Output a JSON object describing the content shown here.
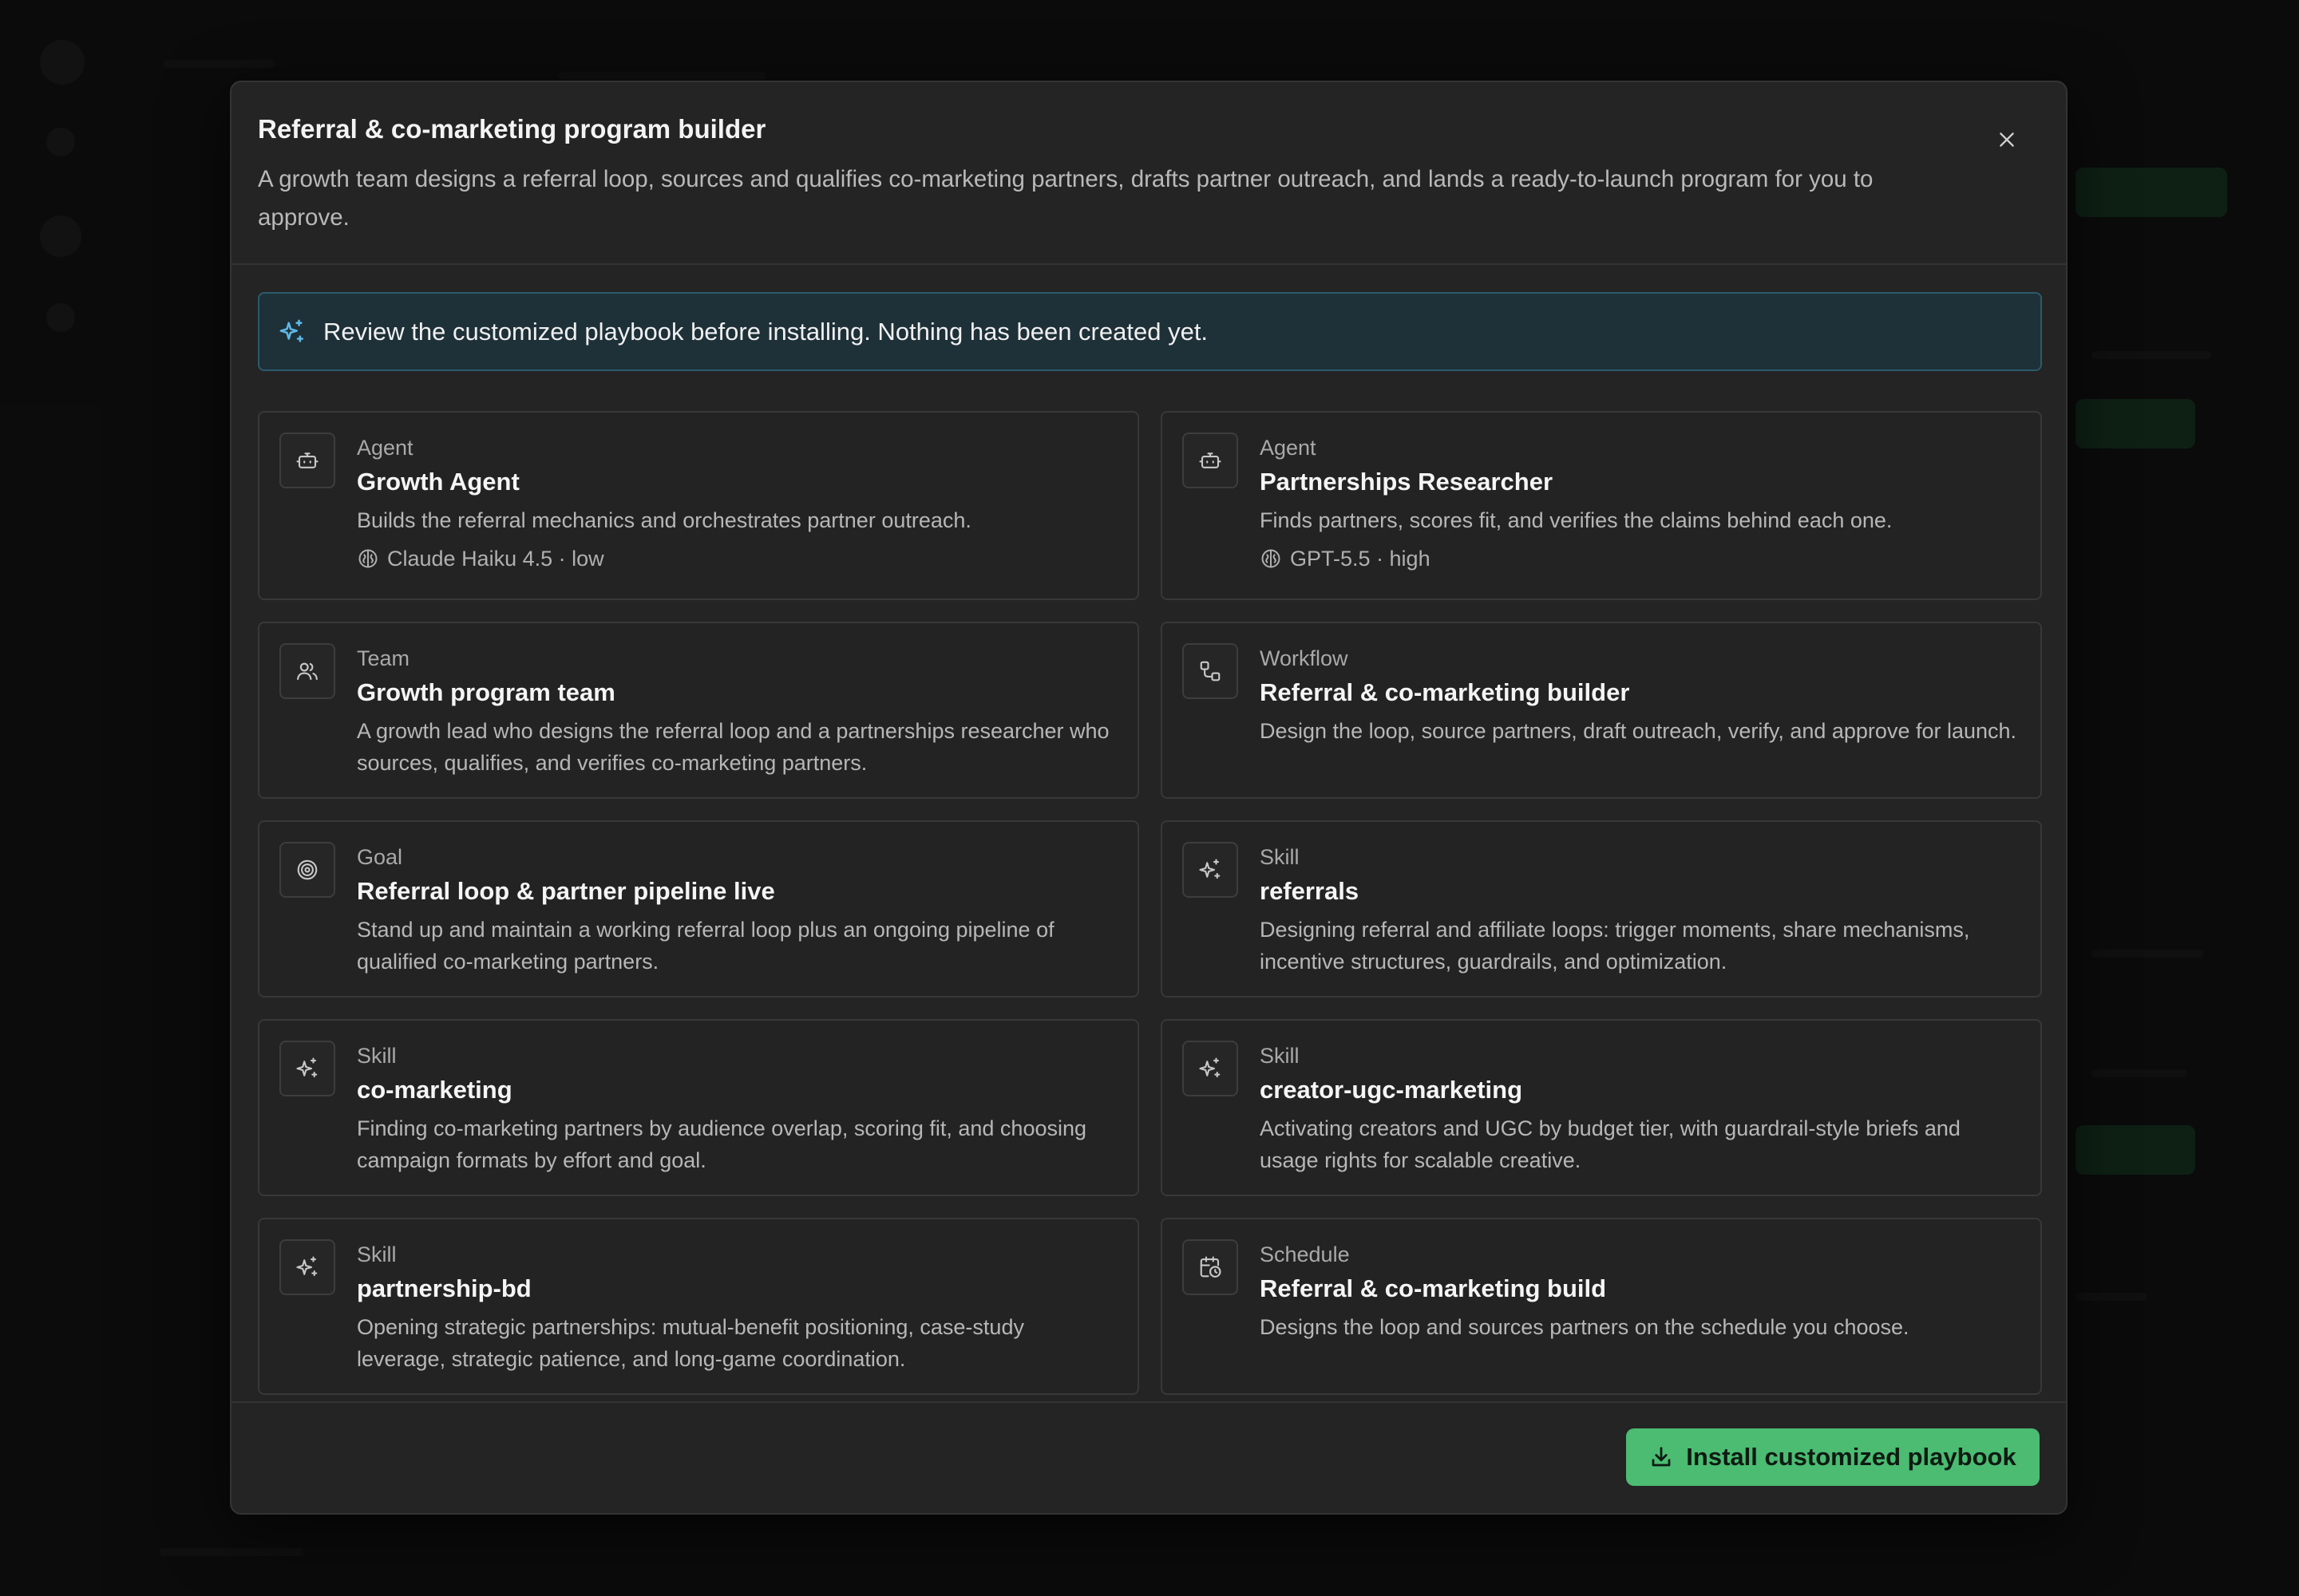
{
  "modal": {
    "title": "Referral & co-marketing program builder",
    "description": "A growth team designs a referral loop, sources and qualifies co-marketing partners, drafts partner outreach, and lands a ready-to-launch program for you to approve.",
    "close_icon": "close-icon"
  },
  "notice": {
    "icon": "sparkles-icon",
    "text": "Review the customized playbook before installing. Nothing has been created yet."
  },
  "cards": [
    {
      "kind": "Agent",
      "title": "Growth Agent",
      "description": "Builds the referral mechanics and orchestrates partner outreach.",
      "meta": "Claude Haiku 4.5 · low",
      "icon": "bot-icon"
    },
    {
      "kind": "Agent",
      "title": "Partnerships Researcher",
      "description": "Finds partners, scores fit, and verifies the claims behind each one.",
      "meta": "GPT-5.5 · high",
      "icon": "bot-icon"
    },
    {
      "kind": "Team",
      "title": "Growth program team",
      "description": "A growth lead who designs the referral loop and a partnerships researcher who sources, qualifies, and verifies co-marketing partners.",
      "icon": "users-icon"
    },
    {
      "kind": "Workflow",
      "title": "Referral & co-marketing builder",
      "description": "Design the loop, source partners, draft outreach, verify, and approve for launch.",
      "icon": "workflow-icon"
    },
    {
      "kind": "Goal",
      "title": "Referral loop & partner pipeline live",
      "description": "Stand up and maintain a working referral loop plus an ongoing pipeline of qualified co-marketing partners.",
      "icon": "target-icon"
    },
    {
      "kind": "Skill",
      "title": "referrals",
      "description": "Designing referral and affiliate loops: trigger moments, share mechanisms, incentive structures, guardrails, and optimization.",
      "icon": "sparkles-icon"
    },
    {
      "kind": "Skill",
      "title": "co-marketing",
      "description": "Finding co-marketing partners by audience overlap, scoring fit, and choosing campaign formats by effort and goal.",
      "icon": "sparkles-icon"
    },
    {
      "kind": "Skill",
      "title": "creator-ugc-marketing",
      "description": "Activating creators and UGC by budget tier, with guardrail-style briefs and usage rights for scalable creative.",
      "icon": "sparkles-icon"
    },
    {
      "kind": "Skill",
      "title": "partnership-bd",
      "description": "Opening strategic partnerships: mutual-benefit positioning, case-study leverage, strategic patience, and long-game coordination.",
      "icon": "sparkles-icon"
    },
    {
      "kind": "Schedule",
      "title": "Referral & co-marketing build",
      "description": "Designs the loop and sources partners on the schedule you choose.",
      "icon": "calendar-clock-icon"
    }
  ],
  "footer": {
    "install_label": "Install customized playbook",
    "install_icon": "download-icon"
  },
  "colors": {
    "accent_green": "#4bbc72",
    "notice_bg": "#1e3038",
    "notice_border": "#2b5a6e",
    "modal_bg": "#242424"
  }
}
